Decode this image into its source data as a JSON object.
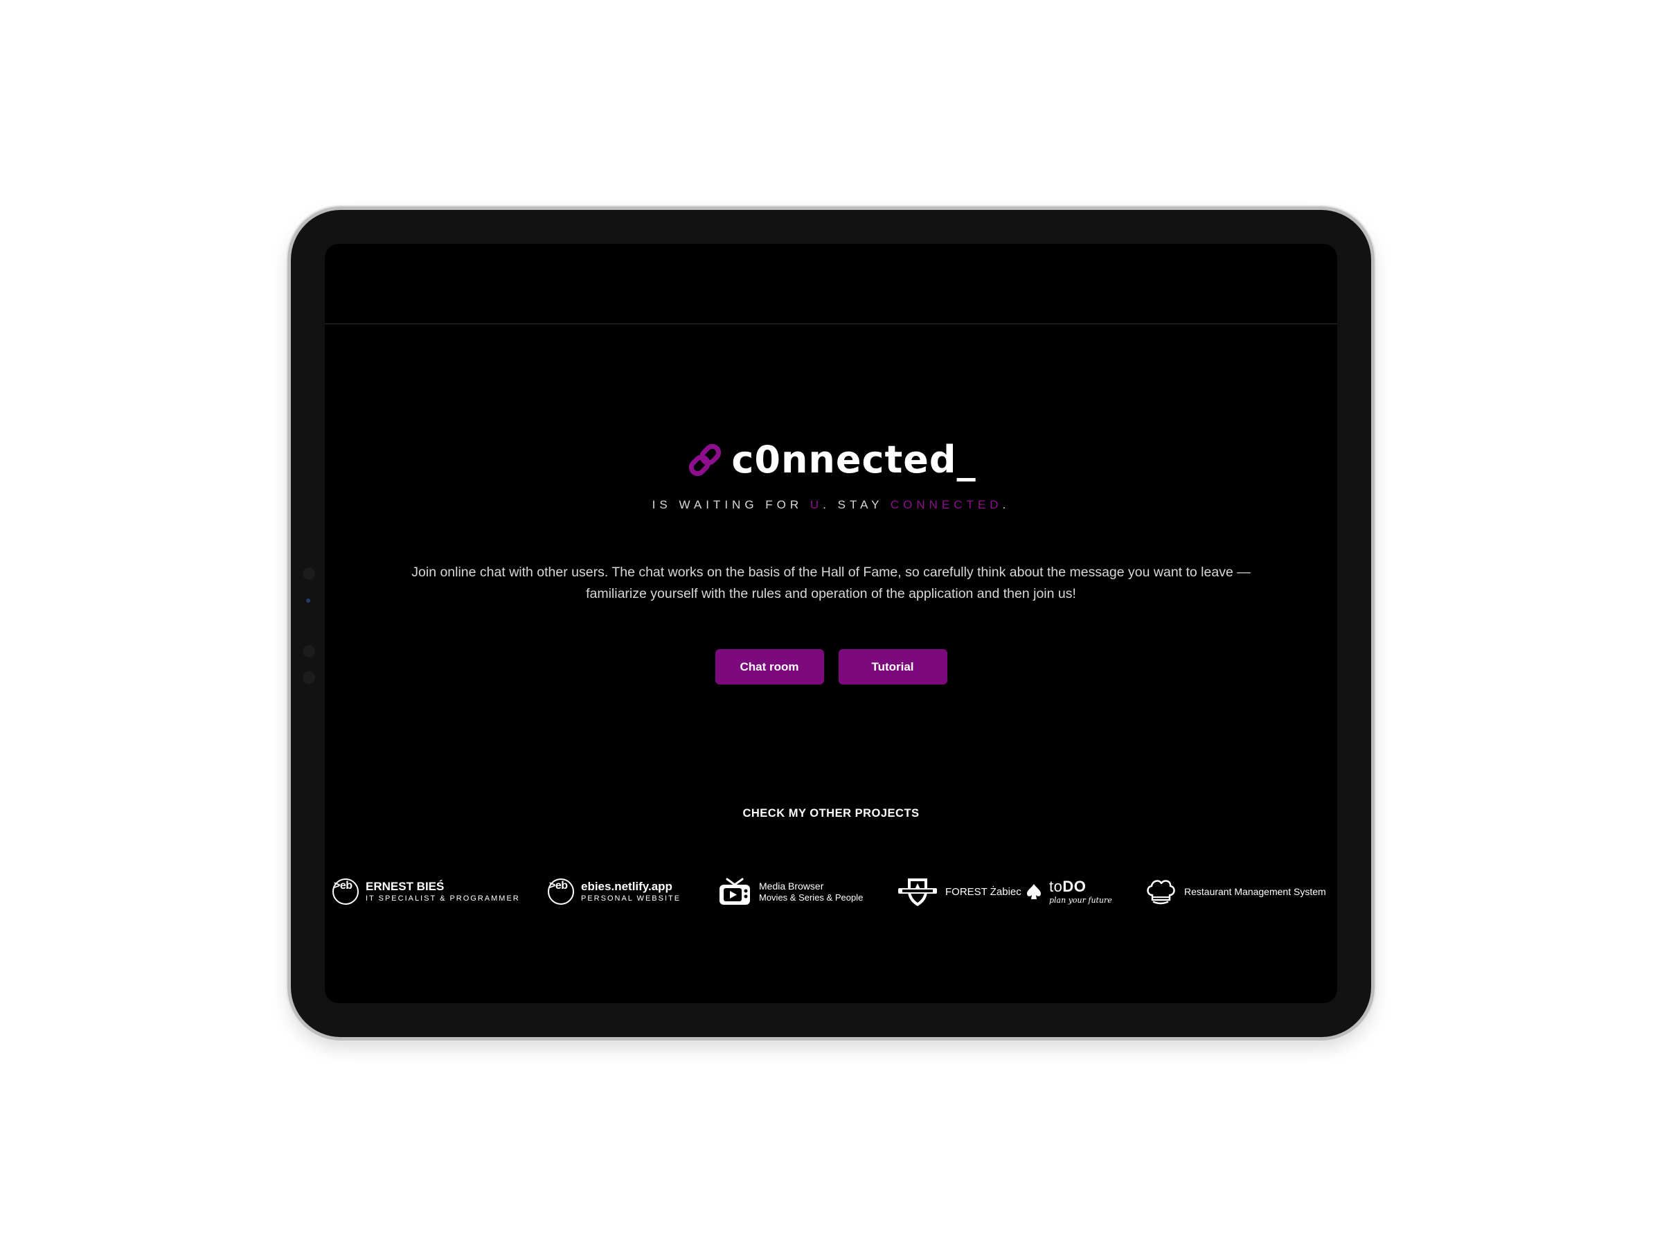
{
  "app": {
    "logo_text": "c0nnected_",
    "brand_color": "#8e0f8e"
  },
  "hero": {
    "tagline_before": "IS WAITING FOR ",
    "tagline_u": "U",
    "tagline_middle": ". STAY ",
    "tagline_connected": "CONNECTED",
    "tagline_end": ".",
    "description": "Join online chat with other users. The chat works on the basis of the Hall of Fame, so carefully think about the message you want to leave — familiarize yourself with the rules and operation of the application and then join us!"
  },
  "buttons": {
    "chat_room": "Chat room",
    "tutorial": "Tutorial",
    "button_color": "#7d0a7d"
  },
  "projects": {
    "title": "CHECK MY OTHER PROJECTS",
    "items": [
      {
        "icon": "eb-logo-icon",
        "badge": ">eb",
        "name": "ERNEST BIEŚ",
        "sub": "IT SPECIALIST & PROGRAMMER"
      },
      {
        "icon": "eb-logo-icon",
        "badge": ">eb",
        "name": "ebies.netlify.app",
        "sub": "PERSONAL WEBSITE"
      },
      {
        "icon": "tv-play-icon",
        "name": "Media Browser",
        "sub": "Movies & Series & People"
      },
      {
        "icon": "shield-emblem-icon",
        "name": "FOREST Żabiec"
      },
      {
        "icon": "spade-icon",
        "name_light": "to",
        "name_bold": "DO",
        "sub": "plan your future"
      },
      {
        "icon": "chef-hat-icon",
        "name": "Restaurant Management System"
      }
    ]
  }
}
